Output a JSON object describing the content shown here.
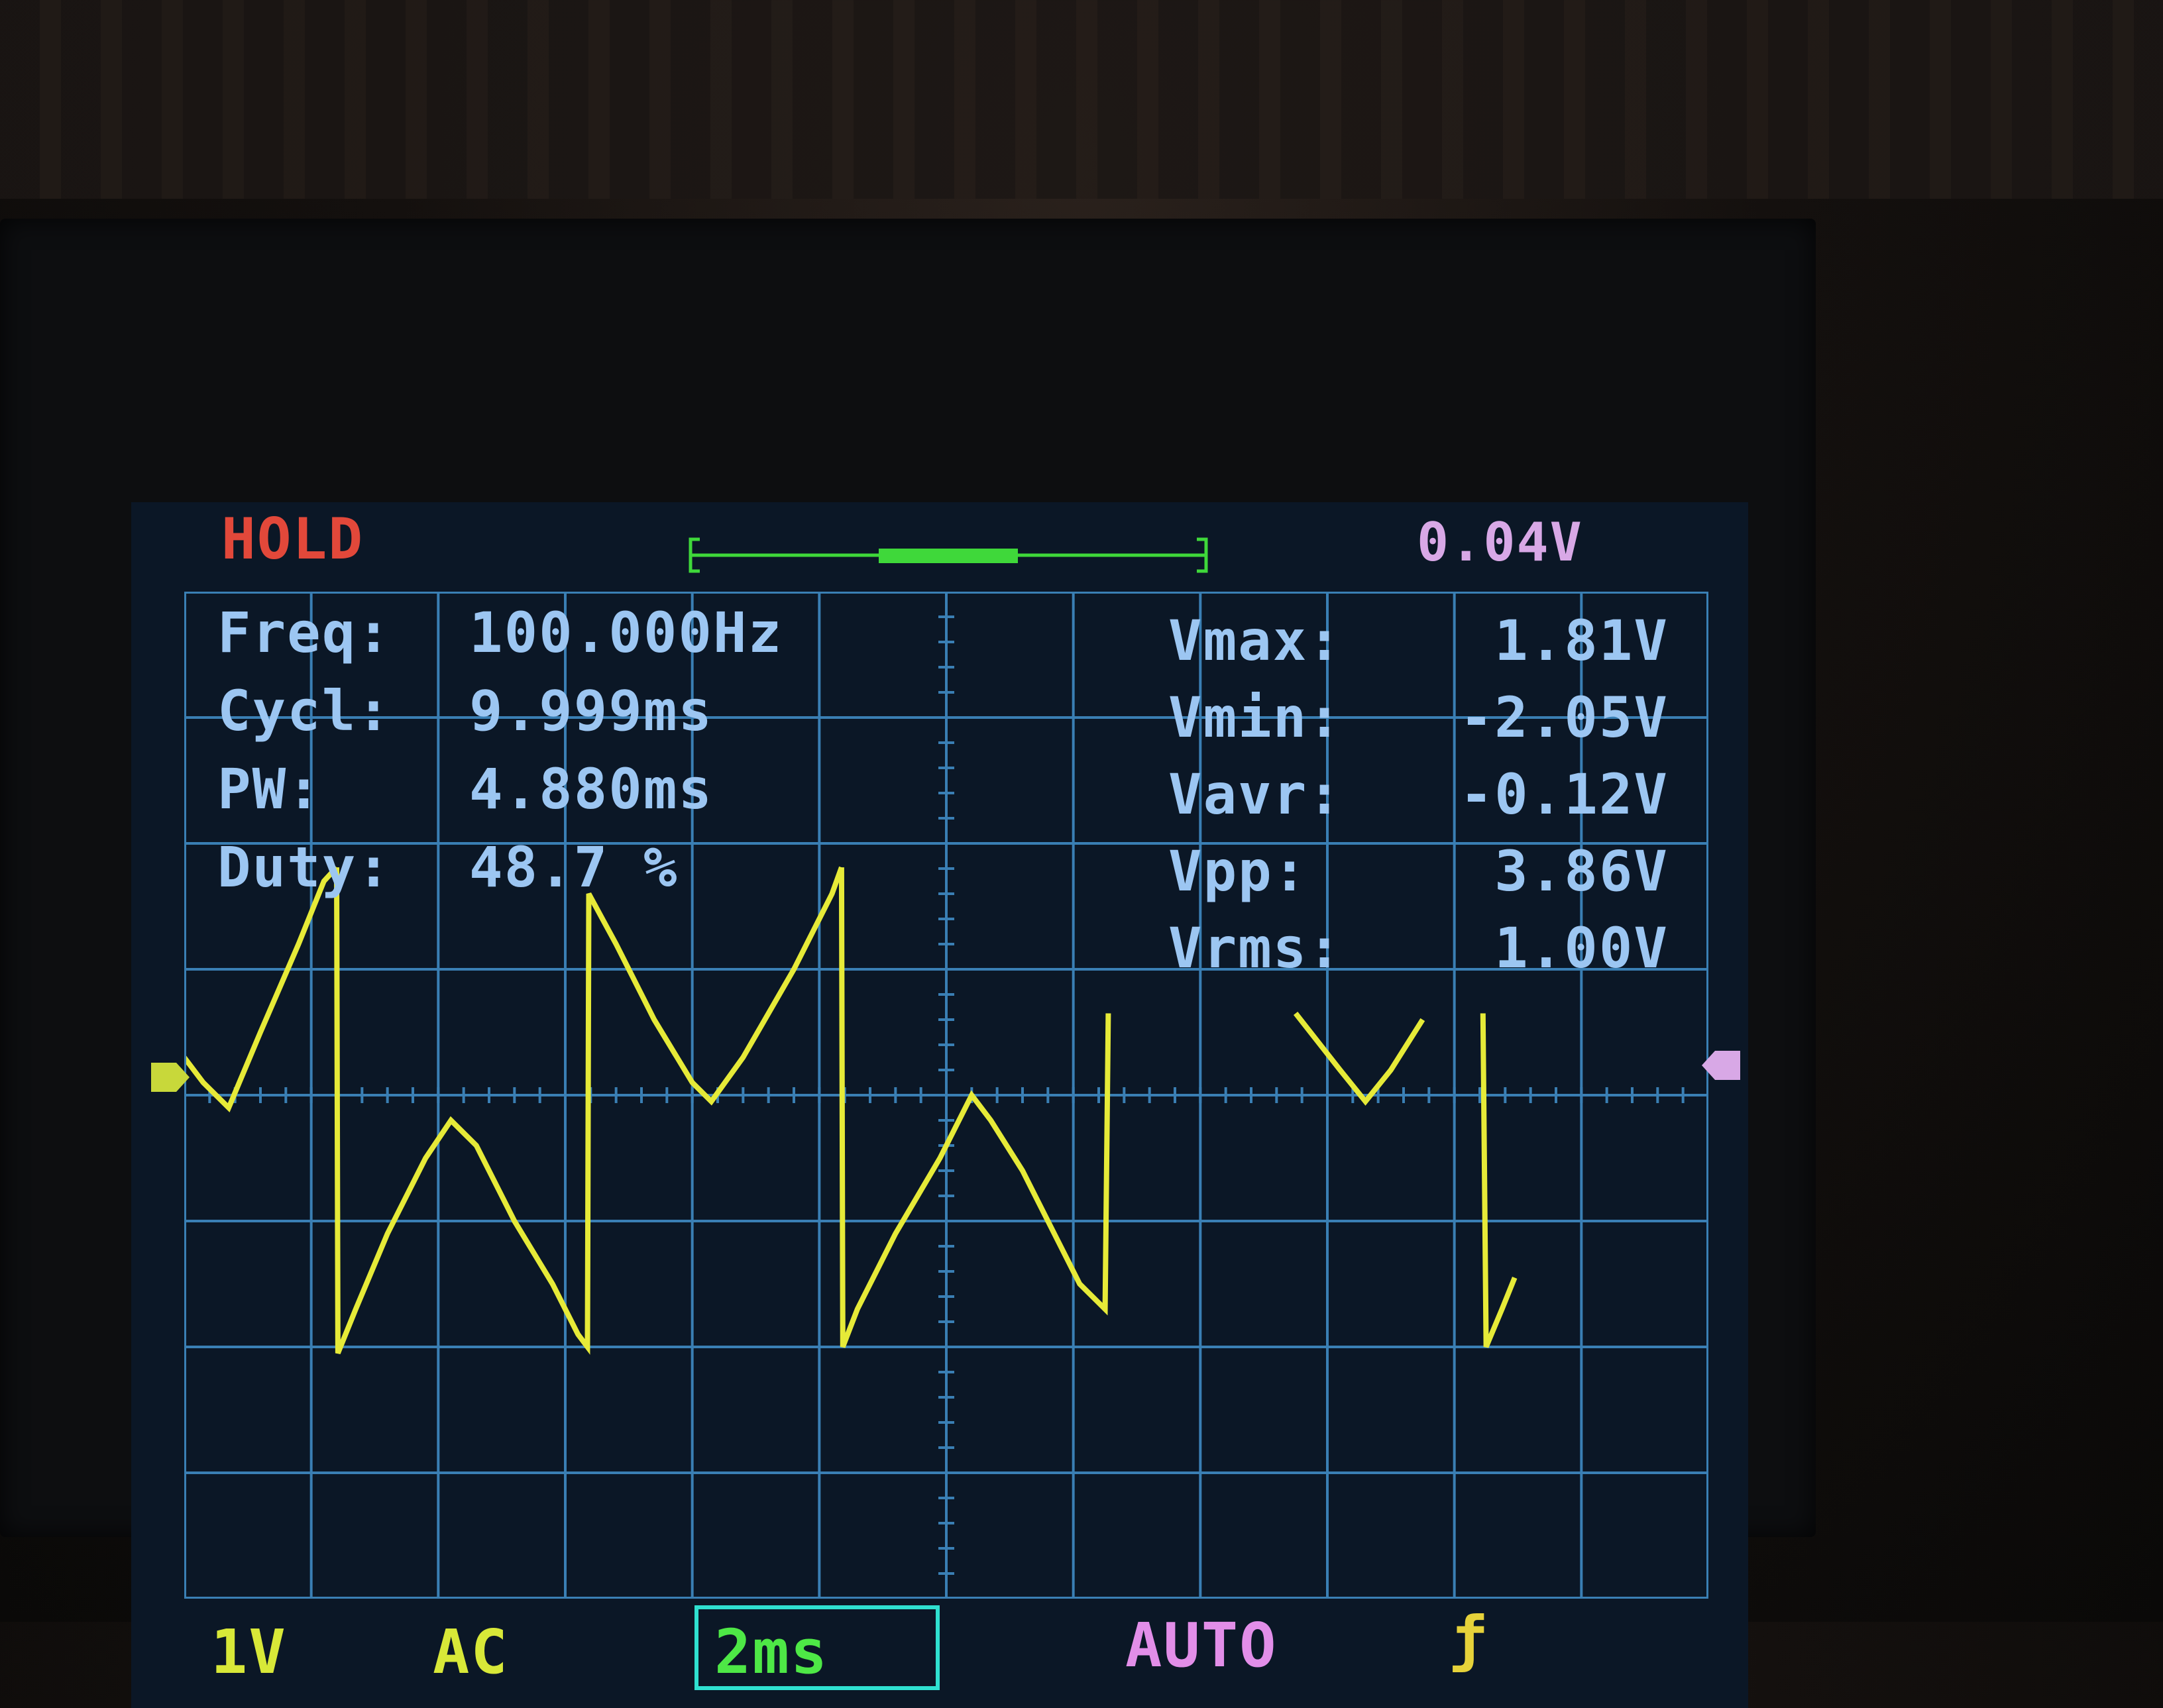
{
  "header": {
    "run_state": "HOLD",
    "trigger_level": "0.04V",
    "timebase_position": 0.5
  },
  "measurements": {
    "left": [
      {
        "label": "Freq:",
        "value": "100.000Hz"
      },
      {
        "label": "Cycl:",
        "value": "9.999ms"
      },
      {
        "label": "PW:",
        "value": "4.880ms"
      },
      {
        "label": "Duty:",
        "value": "48.7 %"
      }
    ],
    "right": [
      {
        "label": "Vmax:",
        "value": "1.81V"
      },
      {
        "label": "Vmin:",
        "value": "-2.05V"
      },
      {
        "label": "Vavr:",
        "value": "-0.12V"
      },
      {
        "label": "Vpp:",
        "value": "3.86V"
      },
      {
        "label": "Vrms:",
        "value": "1.00V"
      }
    ]
  },
  "bottom_bar": {
    "volts_per_div": "1V",
    "coupling": "AC",
    "time_per_div": "2ms",
    "trigger_mode": "AUTO",
    "trigger_edge": "ƒ"
  },
  "colors": {
    "screen_bg": "#0b1726",
    "grid": "#3a7fb4",
    "trace": "#e6ea38",
    "hold_text": "#e2483a",
    "label_text": "#9cc6f2",
    "offset_text": "#d8a8e6",
    "volts_text": "#d8e838",
    "coupling_text": "#d8e838",
    "timebase_text": "#4ee846",
    "timebase_box": "#2fe0d0",
    "mode_text": "#e28ee8",
    "edge_text": "#e6d23a",
    "left_marker": "#c8d83a",
    "right_marker": "#d8a8e6",
    "scroll_bar": "#3fd83a"
  },
  "chart_data": {
    "type": "line",
    "xlabel": "",
    "ylabel": "",
    "xlim": [
      0,
      24
    ],
    "ylim": [
      -4,
      4
    ],
    "grid": true,
    "series": [
      {
        "segments": [
          [
            [
              0.0,
              0.3
            ],
            [
              0.3,
              0.1
            ],
            [
              0.7,
              -0.1
            ],
            [
              1.2,
              0.5
            ],
            [
              1.8,
              1.2
            ],
            [
              2.2,
              1.7
            ],
            [
              2.4,
              1.81
            ]
          ],
          [
            [
              2.4,
              1.81
            ],
            [
              2.42,
              -2.05
            ],
            [
              2.7,
              -1.7
            ],
            [
              3.2,
              -1.1
            ],
            [
              3.8,
              -0.5
            ],
            [
              4.2,
              -0.2
            ],
            [
              4.6,
              -0.4
            ],
            [
              5.2,
              -1.0
            ],
            [
              5.8,
              -1.5
            ],
            [
              6.2,
              -1.9
            ],
            [
              6.35,
              -2.0
            ],
            [
              6.37,
              1.6
            ],
            [
              6.8,
              1.2
            ],
            [
              7.4,
              0.6
            ],
            [
              8.0,
              0.1
            ],
            [
              8.3,
              -0.05
            ],
            [
              8.8,
              0.3
            ],
            [
              9.6,
              1.0
            ],
            [
              10.2,
              1.6
            ],
            [
              10.35,
              1.81
            ]
          ],
          [
            [
              10.35,
              1.81
            ],
            [
              10.37,
              -2.0
            ],
            [
              10.6,
              -1.7
            ],
            [
              11.2,
              -1.1
            ],
            [
              11.9,
              -0.5
            ],
            [
              12.4,
              0.0
            ],
            [
              12.7,
              -0.2
            ],
            [
              13.2,
              -0.6
            ],
            [
              13.7,
              -1.1
            ],
            [
              14.1,
              -1.5
            ],
            [
              14.5,
              -1.7
            ],
            [
              14.55,
              0.65
            ]
          ],
          [
            [
              17.5,
              0.65
            ],
            [
              18.2,
              0.2
            ],
            [
              18.6,
              -0.05
            ],
            [
              19.0,
              0.2
            ],
            [
              19.5,
              0.6
            ]
          ],
          [
            [
              20.45,
              0.65
            ],
            [
              20.5,
              -2.0
            ],
            [
              20.75,
              -1.7
            ],
            [
              20.95,
              -1.45
            ]
          ]
        ]
      }
    ]
  }
}
